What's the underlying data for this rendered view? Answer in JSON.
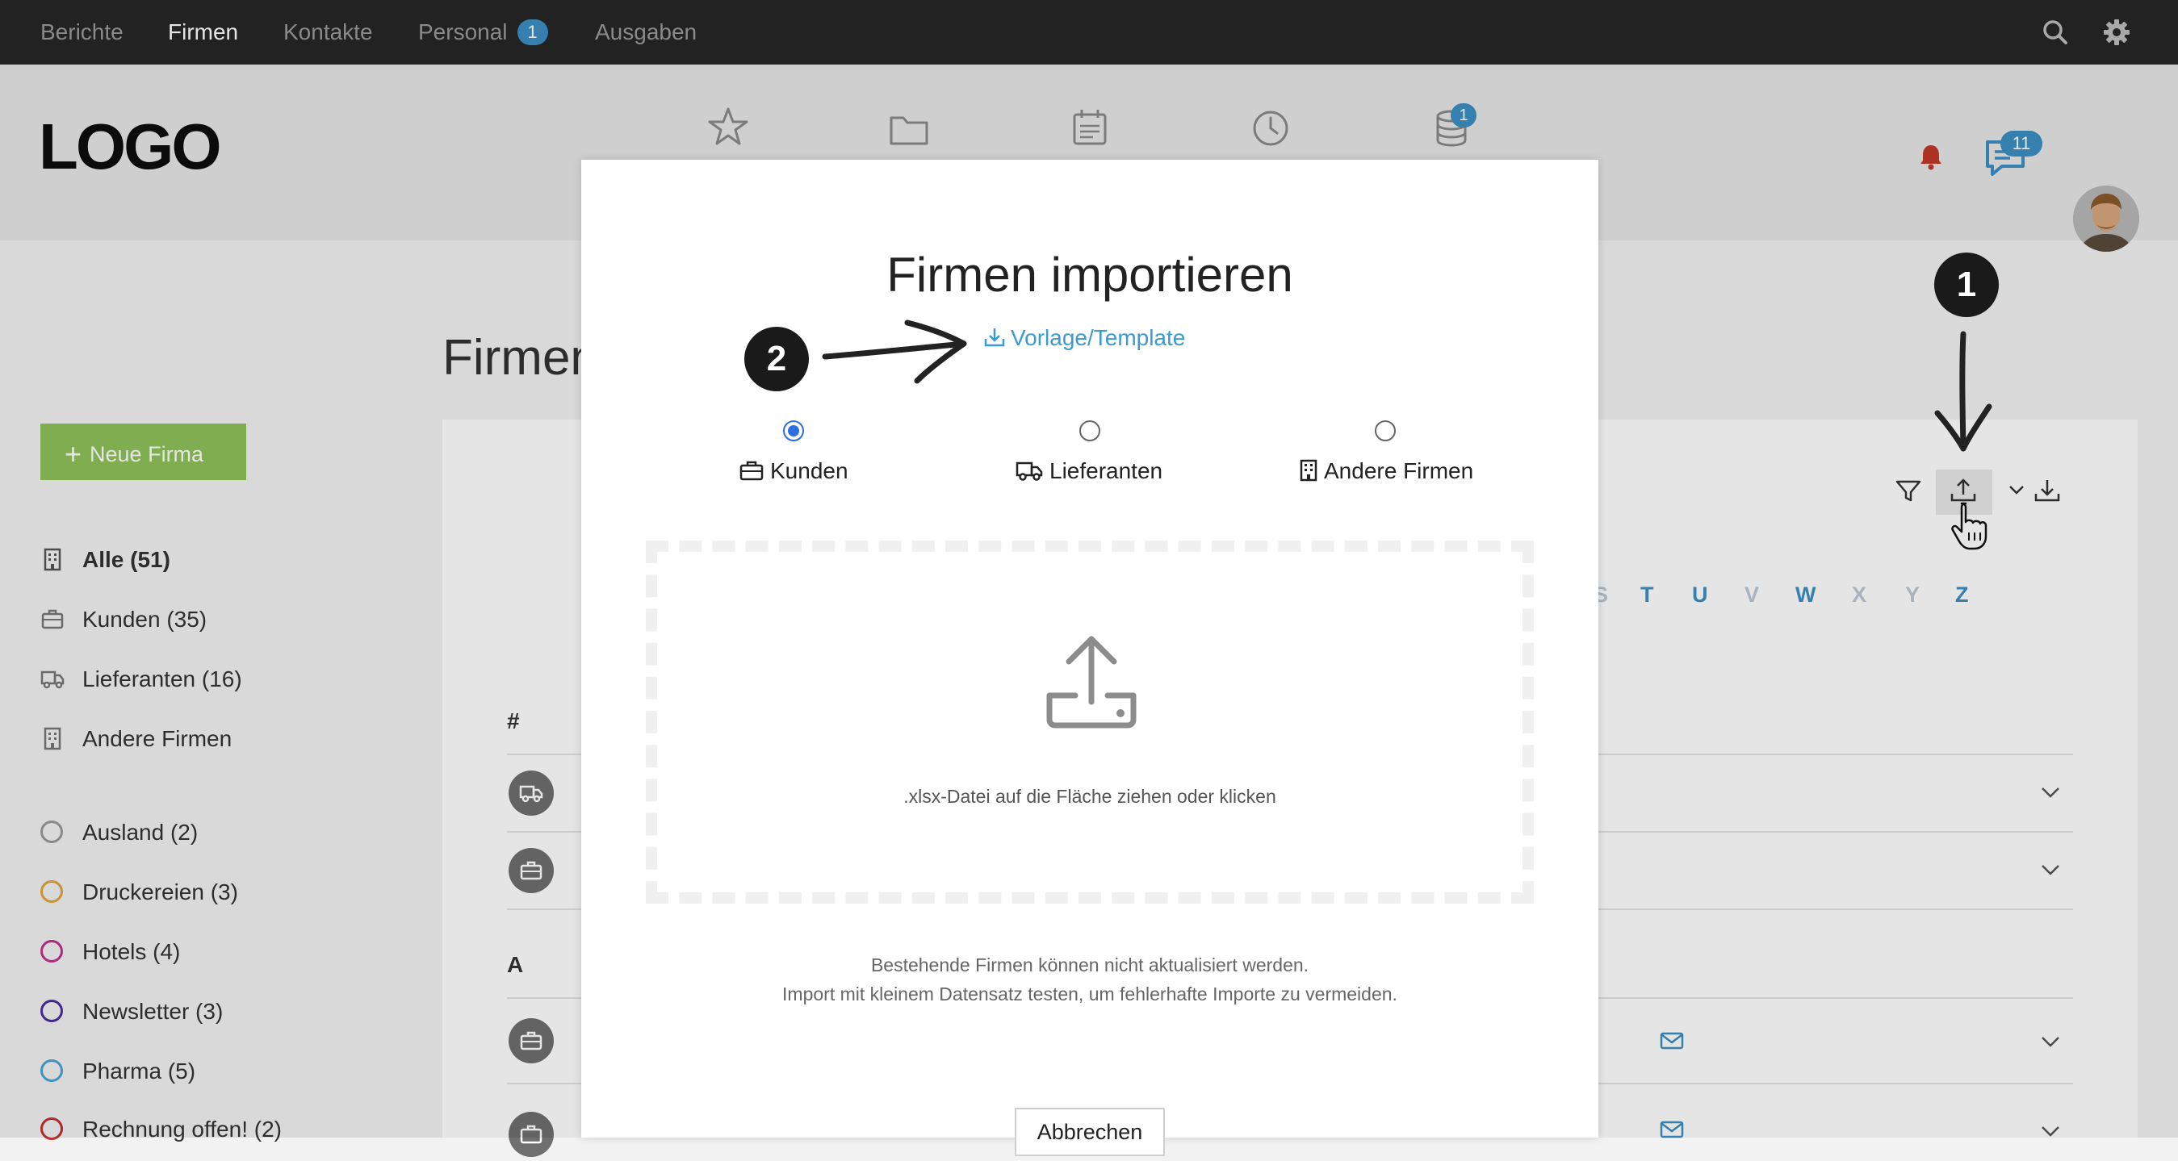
{
  "topnav": {
    "items": [
      {
        "label": "Berichte"
      },
      {
        "label": "Firmen"
      },
      {
        "label": "Kontakte"
      },
      {
        "label": "Personal",
        "badge": "1"
      },
      {
        "label": "Ausgaben"
      }
    ]
  },
  "header": {
    "logo": "LOGO",
    "database_badge": "1",
    "messages_badge": "11"
  },
  "page": {
    "title": "Firmen",
    "new_button": "Neue Firma"
  },
  "sidebar": {
    "categories": [
      {
        "label": "Alle (51)"
      },
      {
        "label": "Kunden (35)"
      },
      {
        "label": "Lieferanten (16)"
      },
      {
        "label": "Andere Firmen"
      }
    ],
    "tags": [
      {
        "label": "Ausland (2)",
        "color": "#9a9a9a"
      },
      {
        "label": "Druckereien (3)",
        "color": "#e3a23b"
      },
      {
        "label": "Hotels (4)",
        "color": "#c0308f"
      },
      {
        "label": "Newsletter (3)",
        "color": "#4b2e9e"
      },
      {
        "label": "Pharma (5)",
        "color": "#4aa3d6"
      },
      {
        "label": "Rechnung offen! (2)",
        "color": "#c0302f"
      }
    ]
  },
  "table": {
    "letters": [
      "S",
      "T",
      "U",
      "V",
      "W",
      "X",
      "Y",
      "Z"
    ],
    "hash_header": "#",
    "section_a": "A"
  },
  "modal": {
    "title": "Firmen importieren",
    "template_link": "Vorlage/Template",
    "options": [
      {
        "label": "Kunden",
        "selected": true
      },
      {
        "label": "Lieferanten",
        "selected": false
      },
      {
        "label": "Andere Firmen",
        "selected": false
      }
    ],
    "dropzone_text": ".xlsx-Datei auf die Fläche ziehen oder klicken",
    "note_line1": "Bestehende Firmen können nicht aktualisiert werden.",
    "note_line2": "Import mit kleinem Datensatz testen, um fehlerhafte Importe zu vermeiden.",
    "cancel_button": "Abbrechen"
  },
  "annotations": {
    "step1": "1",
    "step2": "2"
  },
  "colors": {
    "accent": "#3b9ad1",
    "primary_button": "#8fc15a",
    "radio_selected": "#2d6fe0",
    "topnav_bg": "#262626"
  }
}
